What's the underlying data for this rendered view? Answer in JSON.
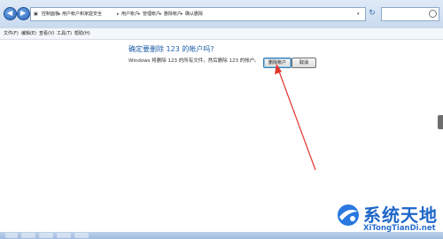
{
  "address_bar": {
    "crumbs": [
      "控制面板",
      "用户帐户和家庭安全",
      "用户帐户",
      "管理帐户",
      "删除帐户",
      "确认删除"
    ]
  },
  "search": {
    "placeholder": ""
  },
  "menubar": {
    "items": [
      "文件(F)",
      "编辑(E)",
      "查看(V)",
      "工具(T)",
      "帮助(H)"
    ]
  },
  "dialog": {
    "heading": "确定要删除 123 的帐户吗?",
    "description": "Windows 将删除 123 的所有文件，然后删除 123 的帐户。",
    "delete_label": "删除帐户",
    "cancel_label": "取消"
  },
  "watermark": {
    "title": "系统天地",
    "url": "XiTongTianDi.net"
  },
  "colors": {
    "heading": "#1f5fa8",
    "annotation_arrow": "#e0352b",
    "watermark": "#1e66c8"
  }
}
